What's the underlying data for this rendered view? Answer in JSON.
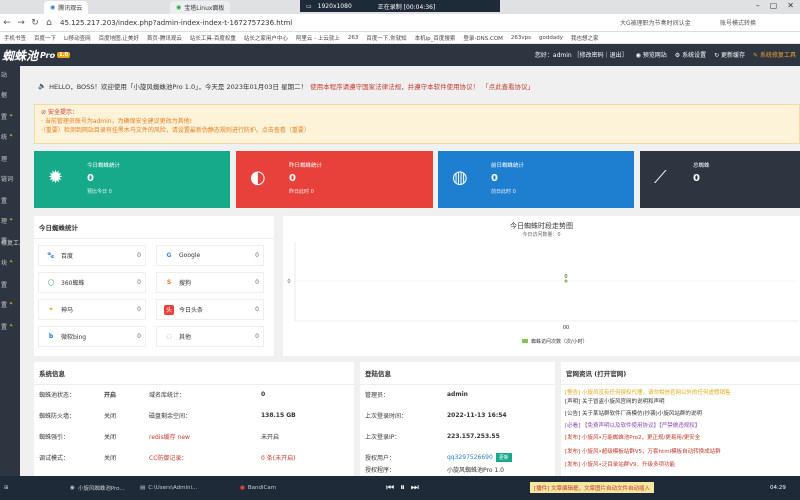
{
  "browser": {
    "tabs": [
      {
        "label": "腾讯观云",
        "active": true
      },
      {
        "label": "宝塔Linux面板",
        "active": false
      }
    ],
    "recorder": {
      "resolution": "1920x1080",
      "status": "正在录制 [00:04:36]"
    },
    "url": "45.125.217.203/index.php?admin-index-index-t-1672757236.html",
    "extensions": [
      "大G被理职为节奏时间认金",
      "账号模式转换"
    ],
    "bookmarks": [
      "手机书签",
      "百度一下",
      "Li移动查网",
      "百度地图,让美好",
      "首页-腾讯观云",
      "站长工具-百度权重",
      "站长之家用户中心",
      "阿里云 - 上云就上",
      "263",
      "百度一下,你就知",
      "本机ip_百度搜索",
      "登录-DNS.COM",
      "263vps",
      "goddady",
      "我也想之家"
    ]
  },
  "topnav": {
    "logo": "蜘蛛池",
    "logo_suffix": "Pro",
    "version": "1.0",
    "right": [
      "您好：admin ［修改密码｜退出］",
      "预览网站",
      "系统设置",
      "更新缓存",
      "系统修复工具"
    ]
  },
  "sidebar": {
    "items": [
      "站",
      "据",
      "置",
      "统",
      "理",
      "链词",
      "置",
      "理",
      "置",
      "修复工具",
      "块",
      "置",
      "置",
      "置"
    ]
  },
  "welcome": {
    "greeting": "HELLO，BOSS！欢迎使用「小旋风蜘蛛池Pro 1.0」，今天是 2023年01月03日 星期二！",
    "law": "使用本程序请遵守国家法律法规，并遵守本软件使用协议！",
    "link": "「点此查看协议」"
  },
  "alert": {
    "title": "安全提示：",
    "line1": "· 当前管理员账号为admin，为确保安全建议更改为其他!",
    "line2": "·（重要）检测到网站目录有挂黑木马文件的风险，请设置最新伪静态规则进行防护。点击查看（重要）"
  },
  "cards": [
    {
      "label": "今日蜘蛛统计",
      "value": "0",
      "sub": "预比今日 0",
      "color": "#16a98a",
      "icon": "sun-icon"
    },
    {
      "label": "昨日蜘蛛统计",
      "value": "0",
      "sub": "昨日此时 0",
      "color": "#e8413c",
      "icon": "moon-icon"
    },
    {
      "label": "前日蜘蛛统计",
      "value": "0",
      "sub": "前日此时 0",
      "color": "#1e7ed0",
      "icon": "globe-icon"
    },
    {
      "label": "总蜘蛛",
      "value": "0",
      "sub": "",
      "color": "#2c3540",
      "icon": "trend-icon"
    }
  ],
  "spider_stats": {
    "title": "今日蜘蛛统计",
    "engines": [
      {
        "name": "百度",
        "count": "0",
        "icon": "baidu-icon",
        "color": "#2932e1"
      },
      {
        "name": "Google",
        "count": "0",
        "icon": "google-icon",
        "color": "#4285f4"
      },
      {
        "name": "360蜘蛛",
        "count": "0",
        "icon": "360-icon",
        "color": "#2ea043"
      },
      {
        "name": "搜狗",
        "count": "0",
        "icon": "sogou-icon",
        "color": "#f37021"
      },
      {
        "name": "神马",
        "count": "0",
        "icon": "shenma-icon",
        "color": "#e6a817"
      },
      {
        "name": "今日头条",
        "count": "0",
        "icon": "toutiao-icon",
        "color": "#e8413c"
      },
      {
        "name": "微软bing",
        "count": "0",
        "icon": "bing-icon",
        "color": "#0078d4"
      },
      {
        "name": "其他",
        "count": "0",
        "icon": "other-icon",
        "color": "#888888"
      }
    ]
  },
  "chart_data": {
    "type": "line",
    "title": "今日蜘蛛时段走势图",
    "subtitle": "今日访问数量：0",
    "x": [
      "00"
    ],
    "series": [
      {
        "name": "蜘蛛访问次数（次/小时）",
        "values": [
          0
        ]
      }
    ],
    "ylabel": "",
    "xlabel": "",
    "ytick": "0",
    "point_label": "0",
    "legend": "bottom",
    "color": "#8bc34a"
  },
  "sysinfo": {
    "title": "系统信息",
    "rows": [
      [
        "蜘蛛池状态：",
        "开启",
        "域名库统计：",
        "0"
      ],
      [
        "蜘蛛防火墙：",
        "关闭",
        "磁盘剩余空间：",
        "138.15 GB"
      ],
      [
        "蜘蛛强引：",
        "关闭",
        "redis缓存 new",
        "未开启"
      ],
      [
        "调试模式：",
        "关闭",
        "CC防御记录：",
        "0 条(未开启)"
      ]
    ]
  },
  "login": {
    "title": "登陆信息",
    "rows": [
      [
        "管理员：",
        "admin"
      ],
      [
        "上次登录时间：",
        "2022-11-13 16:54"
      ],
      [
        "上次登录IP：",
        "223.157.253.55"
      ],
      [
        "授权用户：",
        "qq3297526690"
      ]
    ],
    "update_btn": "更新",
    "program_label": "授权程序：",
    "program_value": "小旋风蜘蛛池Pro 1.0"
  },
  "news": {
    "title": "官网资讯 (打开官网)",
    "items": [
      {
        "text": "[警告] 小旋风没有任何授权代理，请勿相信官网以外的任何虚假销售",
        "color": "#e6a817"
      },
      {
        "text": "[声明] 关于冒盗小旋风官网的说明和声明",
        "color": "#333333"
      },
      {
        "text": "[公告] 关于某站群软件厂商模仿(抄袭)小旋风站群的说明",
        "color": "#333333"
      },
      {
        "text": "[必看] 【免费声明以及软件使用协议】【严禁做违规权】",
        "color": "#8e44ad"
      },
      {
        "text": "[发布] 小旋风•万能蜘蛛池Pro2，更正规/更易用/更安全",
        "color": "#c0392b"
      },
      {
        "text": "[发布] 小旋风•超级模板站群V5，万套html模板自动转换成站群",
        "color": "#c0392b"
      },
      {
        "text": "[发布] 小旋风•泛目录站群V9，升级多项功能",
        "color": "#c0392b"
      }
    ]
  },
  "taskbar": {
    "time": "04:29",
    "items": [
      "小旋风蜘蛛池Pro...",
      "C:\\Users\\Admini...",
      "BandiCam"
    ],
    "promo": "[播件] 文章编辑框，文章图片自动文件自动插入"
  }
}
